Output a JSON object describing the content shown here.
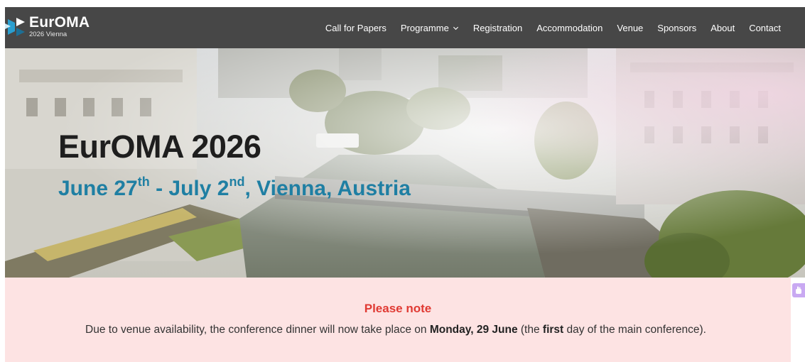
{
  "header": {
    "logo_title": "EurOMA",
    "logo_subtitle": "2026 Vienna",
    "nav": [
      {
        "label": "Call for Papers"
      },
      {
        "label": "Programme",
        "has_dropdown": true
      },
      {
        "label": "Registration"
      },
      {
        "label": "Accommodation"
      },
      {
        "label": "Venue"
      },
      {
        "label": "Sponsors"
      },
      {
        "label": "About"
      },
      {
        "label": "Contact"
      }
    ]
  },
  "hero": {
    "title": "EurOMA 2026",
    "date_start_day": "June 27",
    "date_start_suffix": "th",
    "date_sep": " - ",
    "date_end_day": "July 2",
    "date_end_suffix": "nd",
    "location": ", Vienna, Austria"
  },
  "notice": {
    "title": "Please note",
    "text_before": "Due to venue availability, the conference dinner will now take place on ",
    "text_bold_date": "Monday, 29 June",
    "text_middle": " (the ",
    "text_bold_first": "first",
    "text_after": " day of the main conference)."
  },
  "colors": {
    "header_bg": "#474747",
    "accent_blue": "#1f7fa3",
    "notice_bg": "#fde3e3",
    "notice_title": "#e03a33"
  },
  "icons": {
    "logo": "euroma-logo-icon",
    "dropdown": "chevron-down-icon",
    "side_widget": "hand-icon"
  }
}
